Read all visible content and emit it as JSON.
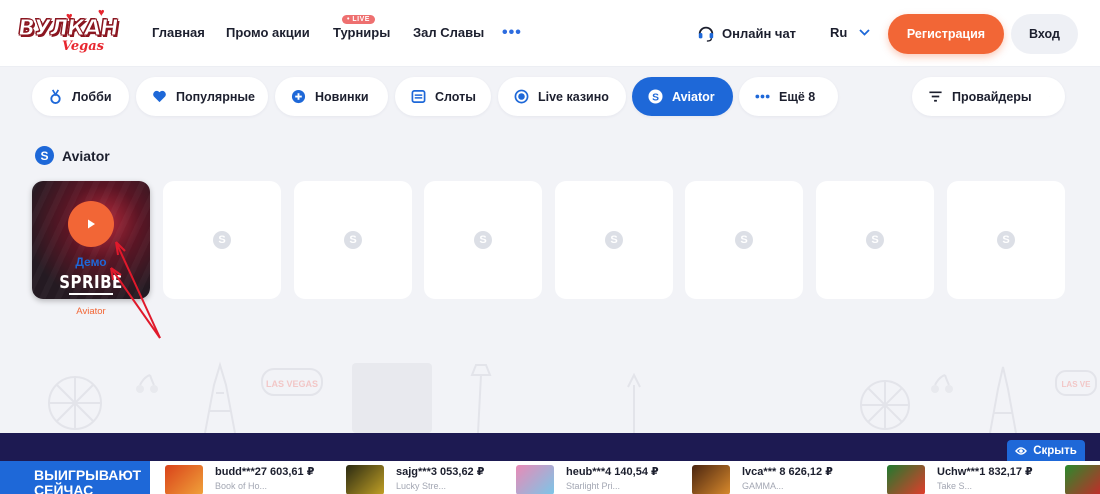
{
  "header": {
    "logo_text": "ВУЛКАН",
    "logo_subtext": "Vegas",
    "nav": [
      "Главная",
      "Промо акции",
      "Турниры",
      "Зал Славы"
    ],
    "live_badge": "• LIVE",
    "more": "•••",
    "chat_label": "Онлайн чат",
    "lang": "Ru",
    "register_label": "Регистрация",
    "login_label": "Вход"
  },
  "categories": [
    {
      "label": "Лобби",
      "icon": "medal-icon"
    },
    {
      "label": "Популярные",
      "icon": "heart-icon"
    },
    {
      "label": "Новинки",
      "icon": "plus-circle-icon"
    },
    {
      "label": "Слоты",
      "icon": "slot-machine-icon"
    },
    {
      "label": "Live казино",
      "icon": "live-icon"
    },
    {
      "label": "Aviator",
      "icon": "spribe-icon",
      "active": true
    },
    {
      "label": "Ещё 8",
      "icon": "dots-icon"
    }
  ],
  "providers_label": "Провайдеры",
  "section": {
    "title": "Aviator",
    "game": {
      "demo": "Демо",
      "brand": "SPRIBE",
      "name": "Aviator"
    },
    "placeholder_glyph": "S"
  },
  "footer": {
    "hide_label": "Скрыть",
    "winners_label": "ВЫИГРЫВАЮТ СЕЙЧАС",
    "winners": [
      {
        "nick": "budd***",
        "amount": "27 603,61 ₽",
        "game": "Book of Ho..."
      },
      {
        "nick": "sajg***",
        "amount": "3 053,62 ₽",
        "game": "Lucky Stre..."
      },
      {
        "nick": "heub***",
        "amount": "4 140,54 ₽",
        "game": "Starlight Pri..."
      },
      {
        "nick": "lvca***",
        "amount": "8 626,12 ₽",
        "game": "GAMMA..."
      },
      {
        "nick": "Uchw***",
        "amount": "1 832,17 ₽",
        "game": "Take S..."
      }
    ]
  },
  "colors": {
    "accent_orange": "#f26636",
    "accent_blue": "#1e68d8",
    "footer_navy": "#1d1a52",
    "annotation_red": "#e0192b"
  }
}
